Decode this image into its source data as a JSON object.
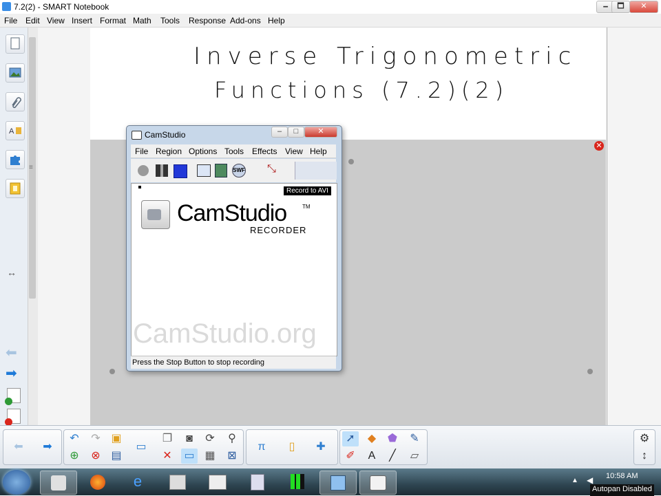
{
  "window": {
    "title": "7.2(2) - SMART Notebook",
    "min": "🗕",
    "max": "🗖",
    "close": "✕"
  },
  "menubar": [
    "File",
    "Edit",
    "View",
    "Insert",
    "Format",
    "Math",
    "Tools",
    "Response",
    "Add-ons",
    "Help"
  ],
  "page": {
    "title_line1": "Inverse Trigonometric",
    "title_line2": "Functions (7.2)(2)"
  },
  "camstudio": {
    "title": "CamStudio",
    "menu": [
      "File",
      "Region",
      "Options",
      "Tools",
      "Effects",
      "View",
      "Help"
    ],
    "tooltip": "Record to AVI",
    "logo_name": "CamStudio",
    "logo_tm": "TM",
    "logo_sub": "RECORDER",
    "watermark": "CamStudio.org",
    "status": "Press the Stop Button to stop recording",
    "swf_label": "SWF"
  },
  "taskbar": {
    "time": "10:58 AM",
    "tooltip": "Autopan Disabled"
  },
  "colors": {
    "accent": "#3a8ee6",
    "delete_red": "#d9261c",
    "cam_stop_blue": "#2238d8"
  }
}
